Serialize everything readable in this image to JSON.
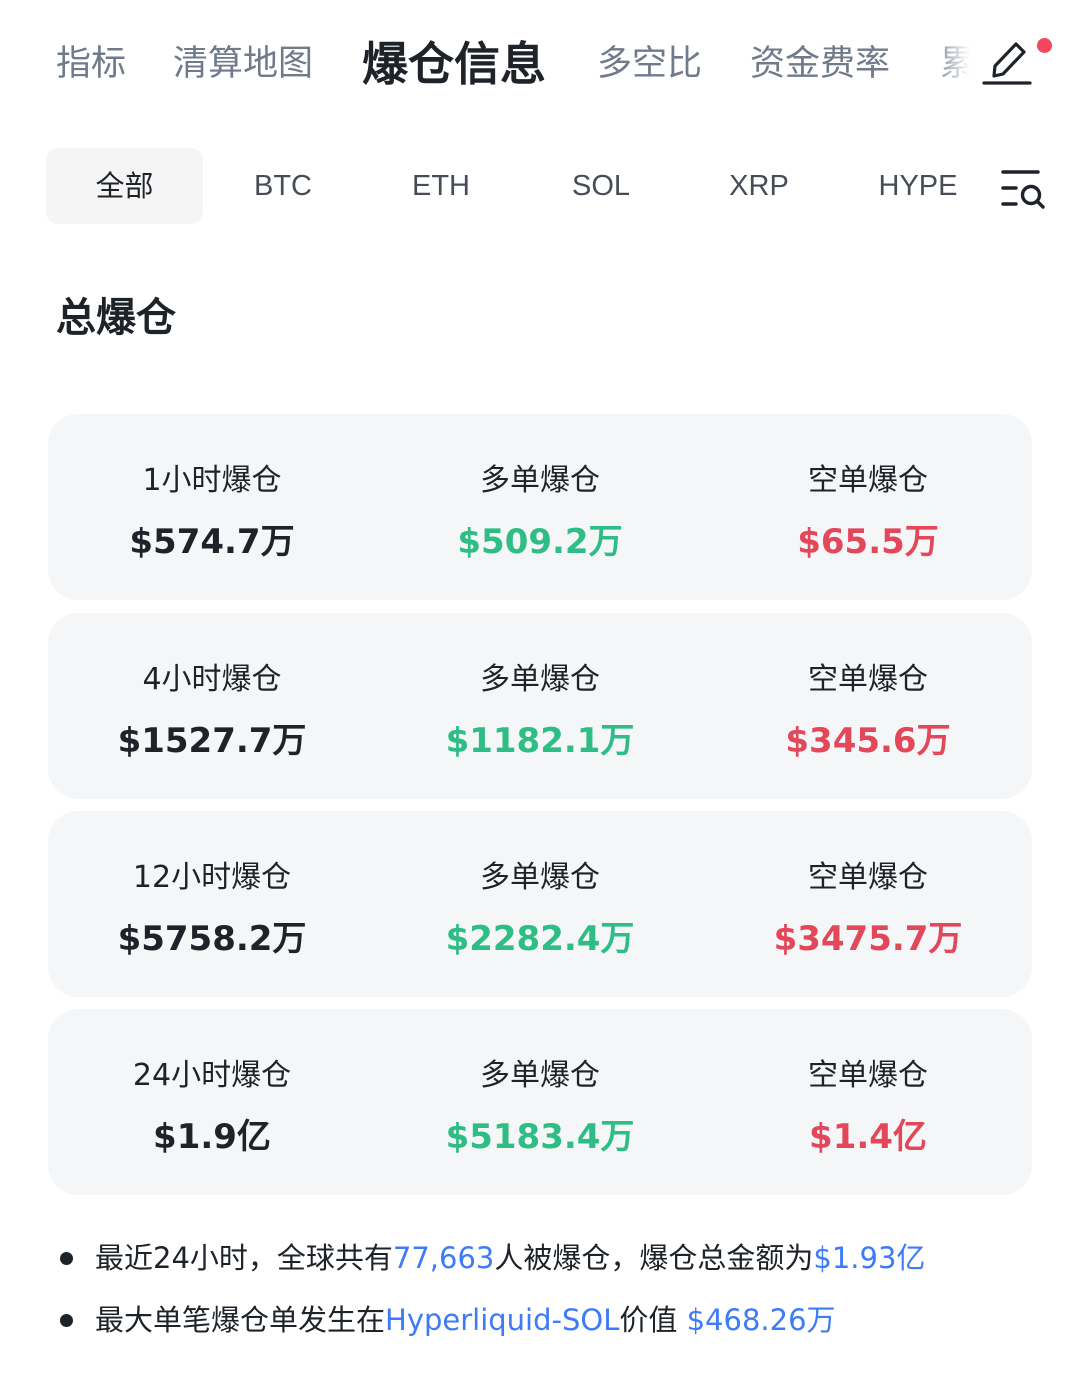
{
  "top_tabs": [
    {
      "label": "指标",
      "active": false
    },
    {
      "label": "清算地图",
      "active": false
    },
    {
      "label": "爆仓信息",
      "active": true
    },
    {
      "label": "多空比",
      "active": false
    },
    {
      "label": "资金费率",
      "active": false
    },
    {
      "label": "累",
      "active": false
    }
  ],
  "edit_button": {
    "icon": "pencil-icon",
    "badge": "red-dot"
  },
  "coin_tabs": [
    {
      "label": "全部",
      "active": true
    },
    {
      "label": "BTC",
      "active": false
    },
    {
      "label": "ETH",
      "active": false
    },
    {
      "label": "SOL",
      "active": false
    },
    {
      "label": "XRP",
      "active": false
    },
    {
      "label": "HYPE",
      "active": false
    }
  ],
  "filter_icon": "list-search-icon",
  "section_title": "总爆仓",
  "cards": [
    {
      "total_label": "1小时爆仓",
      "total_value": "$574.7万",
      "long_label": "多单爆仓",
      "long_value": "$509.2万",
      "short_label": "空单爆仓",
      "short_value": "$65.5万"
    },
    {
      "total_label": "4小时爆仓",
      "total_value": "$1527.7万",
      "long_label": "多单爆仓",
      "long_value": "$1182.1万",
      "short_label": "空单爆仓",
      "short_value": "$345.6万"
    },
    {
      "total_label": "12小时爆仓",
      "total_value": "$5758.2万",
      "long_label": "多单爆仓",
      "long_value": "$2282.4万",
      "short_label": "空单爆仓",
      "short_value": "$3475.7万"
    },
    {
      "total_label": "24小时爆仓",
      "total_value": "$1.9亿",
      "long_label": "多单爆仓",
      "long_value": "$5183.4万",
      "short_label": "空单爆仓",
      "short_value": "$1.4亿"
    }
  ],
  "notes": {
    "line1": {
      "prefix": "最近24小时，全球共有",
      "count": "77,663",
      "middle": "人被爆仓，爆仓总金额为",
      "amount": "$1.93亿"
    },
    "line2": {
      "prefix": "最大单笔爆仓单发生在",
      "pair": "Hyperliquid-SOL",
      "middle": "价值 ",
      "amount": "$468.26万"
    }
  },
  "colors": {
    "long": "#2ebd85",
    "short": "#e2475a",
    "link": "#3d7bf7",
    "card_bg": "#f5f6f8",
    "badge": "#f6465d"
  }
}
